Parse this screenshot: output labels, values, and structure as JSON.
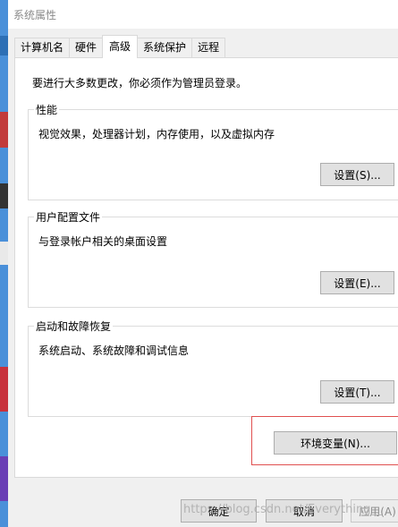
{
  "window": {
    "title": "系统属性"
  },
  "tabs": [
    {
      "label": "计算机名",
      "active": false
    },
    {
      "label": "硬件",
      "active": false
    },
    {
      "label": "高级",
      "active": true
    },
    {
      "label": "系统保护",
      "active": false
    },
    {
      "label": "远程",
      "active": false
    }
  ],
  "advanced": {
    "intro": "要进行大多数更改，你必须作为管理员登录。",
    "performance": {
      "label": "性能",
      "description": "视觉效果，处理器计划，内存使用，以及虚拟内存",
      "button": "设置(S)..."
    },
    "user_profiles": {
      "label": "用户配置文件",
      "description": "与登录帐户相关的桌面设置",
      "button": "设置(E)..."
    },
    "startup_recovery": {
      "label": "启动和故障恢复",
      "description": "系统启动、系统故障和调试信息",
      "button": "设置(T)..."
    },
    "env_button": "环境变量(N)..."
  },
  "footer": {
    "ok": "确定",
    "cancel": "取消",
    "apply": "应用(A)"
  },
  "watermark": "https://blog.csdn.net/Everything__",
  "colors": {
    "highlight_border": "#e05050",
    "button_face": "#e1e1e1",
    "button_border": "#adadad"
  }
}
